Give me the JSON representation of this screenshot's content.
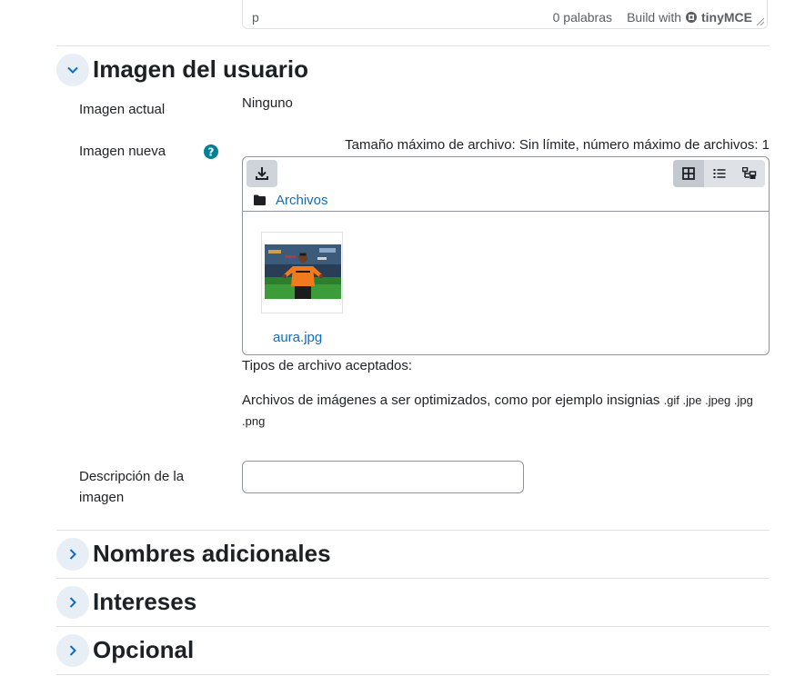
{
  "editor": {
    "path": "p",
    "word_count": "0 palabras",
    "build_with": "Build with",
    "brand": "tinyMCE"
  },
  "section_picture": {
    "title": "Imagen del usuario",
    "current_label": "Imagen actual",
    "current_value": "Ninguno",
    "new_label": "Imagen nueva",
    "max_size": "Tamaño máximo de archivo: Sin límite, número máximo de archivos: 1",
    "folder_label": "Archivos",
    "file_name": "aura.jpg",
    "accepted_title": "Tipos de archivo aceptados:",
    "accepted_desc": "Archivos de imágenes a ser optimizados, como por ejemplo insignias",
    "accepted_ext_line1": ".gif .jpe .jpeg .jpg",
    "accepted_ext_line2": ".png",
    "description_label_1": "Descripción de la",
    "description_label_2": "imagen",
    "description_value": ""
  },
  "sections": [
    {
      "title": "Nombres adicionales"
    },
    {
      "title": "Intereses"
    },
    {
      "title": "Opcional"
    }
  ],
  "colors": {
    "accent": "#0f6cbf",
    "help": "#008196",
    "toggle_bg": "#e7eef6"
  },
  "icons": {
    "help": "help-icon",
    "download": "download-icon",
    "grid_view": "grid-view-icon",
    "list_view": "list-view-icon",
    "tree_view": "tree-view-icon",
    "folder": "folder-icon"
  }
}
